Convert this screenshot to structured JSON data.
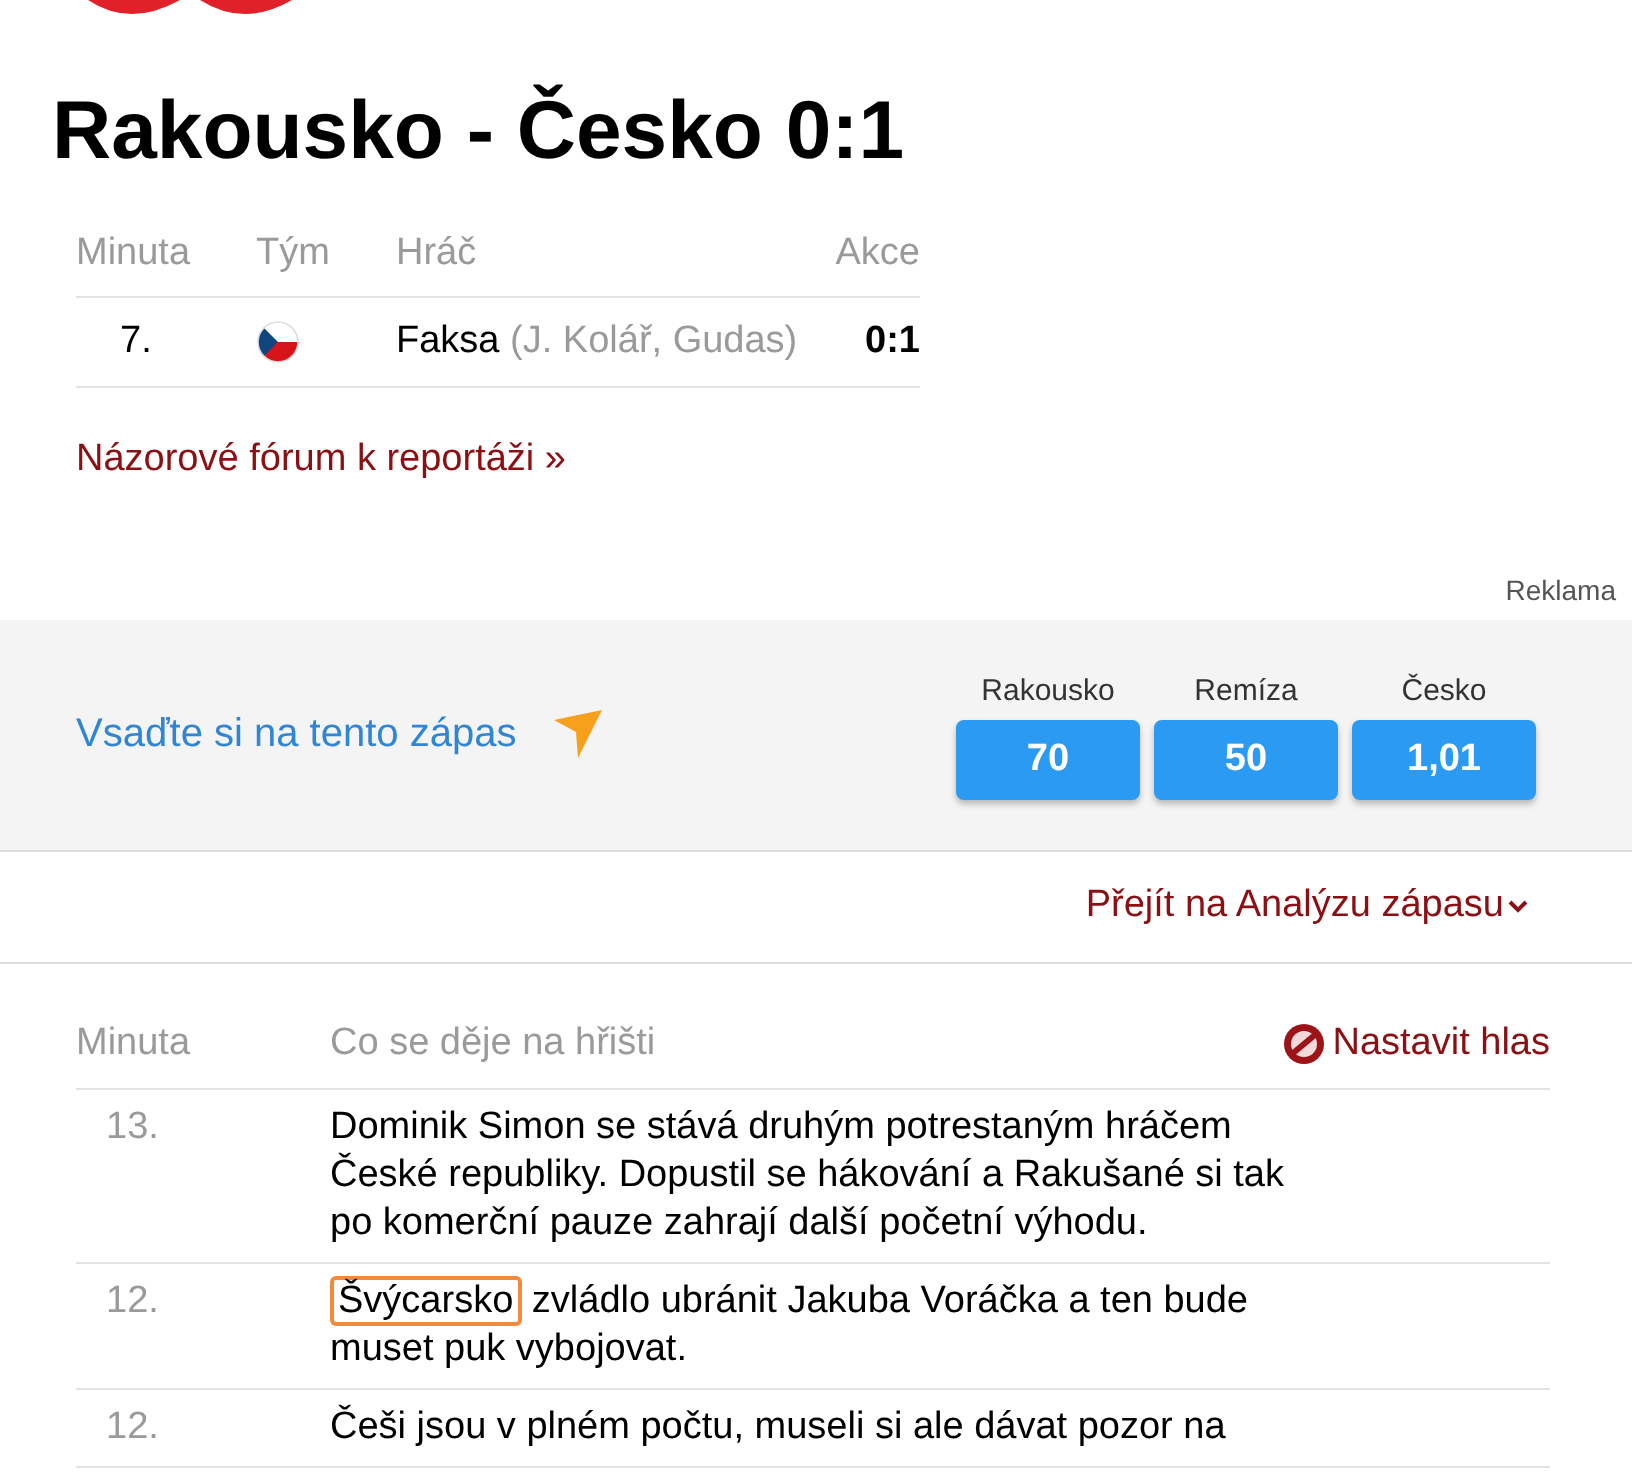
{
  "title": "Rakousko - Česko 0:1",
  "goals": {
    "columns": [
      "Minuta",
      "Tým",
      "Hráč",
      "Akce"
    ],
    "rows": [
      {
        "minute": "7.",
        "player": "Faksa",
        "assists": "(J. Kolář, Gudas)",
        "score": "0:1"
      }
    ]
  },
  "forum_link": "Názorové fórum k reportáži »",
  "ad_label": "Reklama",
  "betting": {
    "prompt": "Vsaďte si na tento zápas",
    "odds": [
      {
        "label": "Rakousko",
        "value": "70"
      },
      {
        "label": "Remíza",
        "value": "50"
      },
      {
        "label": "Česko",
        "value": "1,01"
      }
    ]
  },
  "analysis_link": "Přejít na Analýzu zápasu",
  "commentary": {
    "columns": [
      "Minuta",
      "Co se děje na hřišti"
    ],
    "sound_toggle": "Nastavit hlas",
    "rows": [
      {
        "minute": "13.",
        "segments": [
          {
            "text": "Dominik Simon se stává druhým potrestaným hráčem České republiky. Dopustil se hákování a Rakušané si tak po komerční pauze zahrají další početní výhodu.",
            "circled": false
          }
        ]
      },
      {
        "minute": "12.",
        "segments": [
          {
            "text": "Švýcarsko",
            "circled": true
          },
          {
            "text": " zvládlo ubránit Jakuba Voráčka a ten bude muset puk vybojovat.",
            "circled": false
          }
        ]
      },
      {
        "minute": "12.",
        "segments": [
          {
            "text": "Češi jsou v plném počtu, museli si ale dávat pozor na",
            "circled": false
          }
        ]
      }
    ]
  }
}
